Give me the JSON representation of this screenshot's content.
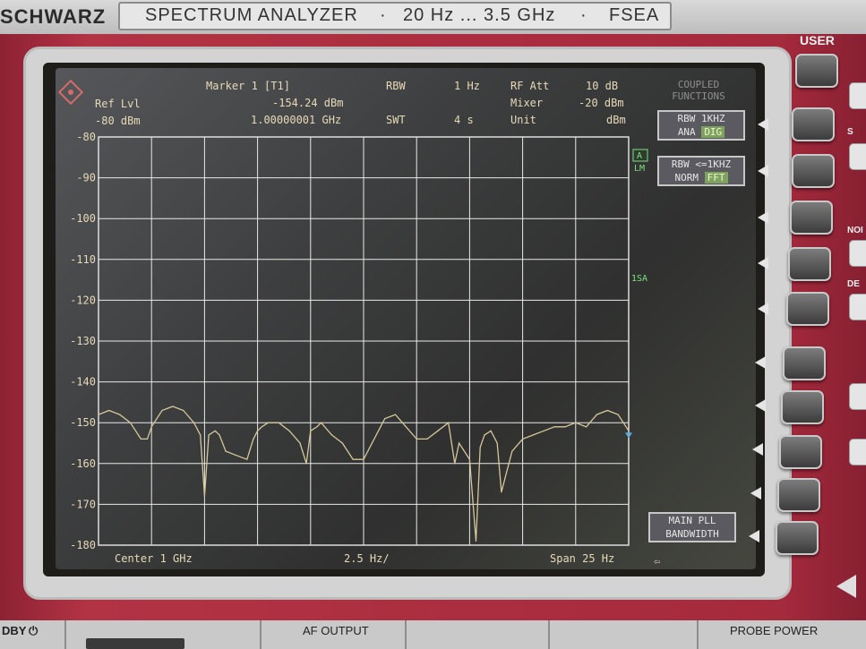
{
  "header": {
    "brand": "SCHWARZ",
    "model_parts": [
      "SPECTRUM ANALYZER",
      "·",
      "20 Hz ... 3.5 GHz",
      "·",
      "FSEA"
    ]
  },
  "display": {
    "marker_label": "Marker 1 [T1]",
    "marker_level": "-154.24 dBm",
    "marker_freq": "1.00000001 GHz",
    "ref_lvl_label": "Ref Lvl",
    "ref_lvl_value": "-80 dBm",
    "rbw_label": "RBW",
    "rbw_value": "1 Hz",
    "swt_label": "SWT",
    "swt_value": "4 s",
    "rf_att_label": "RF Att",
    "rf_att_value": "10 dB",
    "mixer_label": "Mixer",
    "mixer_value": "-20 dBm",
    "unit_label": "Unit",
    "unit_value": "dBm",
    "trace_a": "A",
    "trace_lm": "LM",
    "trace_1sa": "1SA",
    "center_label": "Center 1 GHz",
    "div_label": "2.5 Hz/",
    "span_label": "Span 25 Hz",
    "back_arrow": "⇦"
  },
  "softkeys": {
    "title_line1": "COUPLED",
    "title_line2": "FUNCTIONS",
    "rbw1_top": "RBW 1KHZ",
    "rbw1_opt1": "ANA",
    "rbw1_opt2": "DIG",
    "rbw2_top": "RBW <=1KHZ",
    "rbw2_opt1": "NORM",
    "rbw2_opt2": "FFT",
    "pll_line1": "MAIN PLL",
    "pll_line2": "BANDWIDTH"
  },
  "panel": {
    "user_label": "USER",
    "side_labels": [
      "S",
      "NOI",
      "DE"
    ],
    "bottom_labels": [
      "DBY",
      "AF OUTPUT",
      "PROBE POWER"
    ],
    "standby_icon": "power-icon"
  },
  "colors": {
    "lcd_text": "#e8d9b8",
    "grid": "#e9e9e9",
    "trace": "#d6c79a",
    "accent_green": "#7de07d",
    "body_maroon": "#a52a3c"
  },
  "chart_data": {
    "type": "line",
    "title": "",
    "xlabel": "",
    "ylabel": "",
    "x_unit": "Hz offset from center",
    "xlim": [
      -12.5,
      12.5
    ],
    "ylim": [
      -180,
      -80
    ],
    "yticks": [
      -80,
      -90,
      -100,
      -110,
      -120,
      -130,
      -140,
      -150,
      -160,
      -170,
      -180
    ],
    "grid": true,
    "x": [
      -12.5,
      -12.0,
      -11.5,
      -11.0,
      -10.5,
      -10.2,
      -10.0,
      -9.5,
      -9.0,
      -8.5,
      -8.0,
      -7.7,
      -7.5,
      -7.3,
      -7.0,
      -6.8,
      -6.5,
      -6.0,
      -5.5,
      -5.2,
      -5.0,
      -4.8,
      -4.5,
      -4.0,
      -3.5,
      -3.0,
      -2.7,
      -2.5,
      -2.2,
      -2.0,
      -1.5,
      -1.0,
      -0.5,
      0.0,
      0.5,
      0.8,
      1.0,
      1.5,
      2.0,
      2.5,
      3.0,
      3.5,
      4.0,
      4.3,
      4.5,
      5.0,
      5.3,
      5.5,
      5.7,
      6.0,
      6.3,
      6.5,
      7.0,
      7.5,
      8.0,
      8.5,
      9.0,
      9.5,
      10.0,
      10.5,
      11.0,
      11.5,
      12.0,
      12.5
    ],
    "y": [
      -148,
      -147,
      -148,
      -150,
      -154,
      -154,
      -151,
      -147,
      -146,
      -147,
      -150,
      -153,
      -168,
      -153,
      -152,
      -153,
      -157,
      -158,
      -159,
      -154,
      -152,
      -151,
      -150,
      -150,
      -152,
      -155,
      -160,
      -152,
      -151,
      -150,
      -153,
      -155,
      -159,
      -159,
      -154,
      -151,
      -149,
      -148,
      -151,
      -154,
      -154,
      -152,
      -150,
      -160,
      -155,
      -159,
      -179,
      -156,
      -153,
      -152,
      -155,
      -167,
      -157,
      -154,
      -153,
      -152,
      -151,
      -151,
      -150,
      -151,
      -148,
      -147,
      -148,
      -152
    ]
  }
}
